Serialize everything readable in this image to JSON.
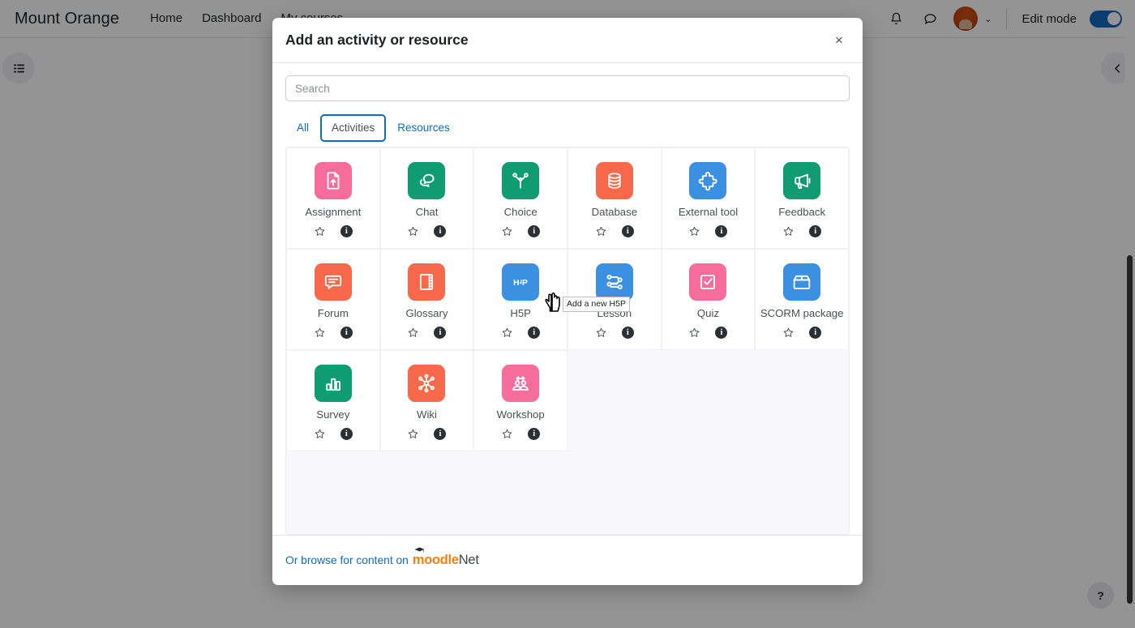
{
  "topnav": {
    "brand": "Mount Orange",
    "links": [
      {
        "label": "Home",
        "active": false
      },
      {
        "label": "Dashboard",
        "active": false
      },
      {
        "label": "My courses",
        "active": true
      }
    ],
    "notifications_icon": "bell-icon",
    "messages_icon": "message-icon",
    "avatar_caret": "⌄",
    "edit_mode_label": "Edit mode",
    "edit_mode_on": true
  },
  "page": {
    "side_toggle_icon": "list-menu-icon",
    "drawer_toggle_icon": "chevron-left-icon",
    "help_label": "?"
  },
  "modal": {
    "title": "Add an activity or resource",
    "close_label": "×",
    "search": {
      "value": "",
      "placeholder": "Search"
    },
    "tabs": [
      {
        "label": "All",
        "active": false
      },
      {
        "label": "Activities",
        "active": true
      },
      {
        "label": "Resources",
        "active": false
      }
    ],
    "footer": {
      "prefix": "Or browse for content on",
      "brand_part1": "moodle",
      "brand_part2": "Net"
    }
  },
  "tooltip": {
    "text": "Add a new H5P"
  },
  "colors": {
    "pink": "#f66d9b",
    "green": "#0f9d6f",
    "orange": "#f7694a",
    "blue": "#3b90e2",
    "accent_blue": "#0f6cbf",
    "moodlenet_orange": "#f98012"
  },
  "activities": [
    {
      "name": "Assignment",
      "icon": "assignment-icon",
      "color": "#f66d9b",
      "star": "☆",
      "info": "i"
    },
    {
      "name": "Chat",
      "icon": "chat-icon",
      "color": "#0f9d6f",
      "star": "☆",
      "info": "i"
    },
    {
      "name": "Choice",
      "icon": "choice-icon",
      "color": "#0f9d6f",
      "star": "☆",
      "info": "i"
    },
    {
      "name": "Database",
      "icon": "database-icon",
      "color": "#f7694a",
      "star": "☆",
      "info": "i"
    },
    {
      "name": "External tool",
      "icon": "puzzle-icon",
      "color": "#3b90e2",
      "star": "☆",
      "info": "i"
    },
    {
      "name": "Feedback",
      "icon": "megaphone-icon",
      "color": "#0f9d6f",
      "star": "☆",
      "info": "i"
    },
    {
      "name": "Forum",
      "icon": "forum-icon",
      "color": "#f7694a",
      "star": "☆",
      "info": "i"
    },
    {
      "name": "Glossary",
      "icon": "book-icon",
      "color": "#f7694a",
      "star": "☆",
      "info": "i"
    },
    {
      "name": "H5P",
      "icon": "h5p-icon",
      "color": "#3b90e2",
      "star": "☆",
      "info": "i"
    },
    {
      "name": "Lesson",
      "icon": "lesson-path-icon",
      "color": "#3b90e2",
      "star": "☆",
      "info": "i"
    },
    {
      "name": "Quiz",
      "icon": "quiz-check-icon",
      "color": "#f66d9b",
      "star": "☆",
      "info": "i"
    },
    {
      "name": "SCORM package",
      "icon": "package-box-icon",
      "color": "#3b90e2",
      "star": "☆",
      "info": "i"
    },
    {
      "name": "Survey",
      "icon": "bar-chart-icon",
      "color": "#0f9d6f",
      "star": "☆",
      "info": "i"
    },
    {
      "name": "Wiki",
      "icon": "network-nodes-icon",
      "color": "#f7694a",
      "star": "☆",
      "info": "i"
    },
    {
      "name": "Workshop",
      "icon": "workshop-peer-icon",
      "color": "#f66d9b",
      "star": "☆",
      "info": "i"
    }
  ]
}
